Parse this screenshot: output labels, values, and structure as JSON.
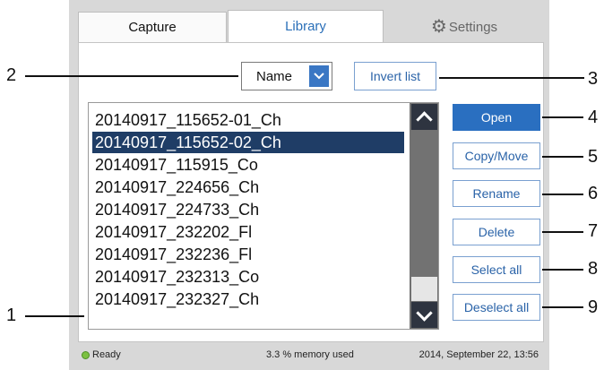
{
  "tabs": [
    {
      "label": "Capture"
    },
    {
      "label": "Library"
    },
    {
      "label": "Settings",
      "icon": "gear-icon"
    }
  ],
  "sort": {
    "selected": "Name"
  },
  "invert_label": "Invert list",
  "files": [
    "20140917_115652-01_Ch",
    "20140917_115652-02_Ch",
    "20140917_115915_Co",
    "20140917_224656_Ch",
    "20140917_224733_Ch",
    "20140917_232202_Fl",
    "20140917_232236_Fl",
    "20140917_232313_Co",
    "20140917_232327_Ch"
  ],
  "selected_file": "20140917_115652-02_Ch",
  "actions": {
    "open": "Open",
    "copy_move": "Copy/Move",
    "rename": "Rename",
    "delete": "Delete",
    "select_all": "Select all",
    "deselect_all": "Deselect all"
  },
  "status": {
    "ready": "Ready",
    "memory": "3.3 % memory used",
    "datetime": "2014, September 22, 13:56"
  },
  "callouts": [
    "1",
    "2",
    "3",
    "4",
    "5",
    "6",
    "7",
    "8",
    "9"
  ],
  "colors": {
    "accent": "#2a6fc0",
    "selection": "#1f3d66",
    "ready_indicator": "#7cc142"
  }
}
